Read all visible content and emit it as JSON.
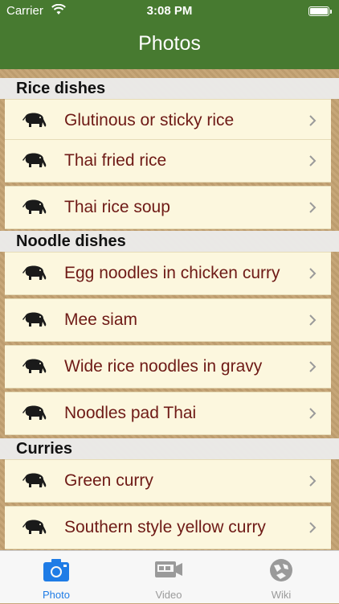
{
  "status": {
    "carrier": "Carrier",
    "time": "3:08 PM"
  },
  "nav": {
    "title": "Photos"
  },
  "sections": [
    {
      "title": "Rice dishes",
      "items": [
        "Glutinous or sticky rice",
        "Thai fried rice",
        "Thai rice soup"
      ]
    },
    {
      "title": "Noodle dishes",
      "items": [
        "Egg noodles in chicken curry",
        "Mee siam",
        "Wide rice noodles in gravy",
        "Noodles pad Thai"
      ]
    },
    {
      "title": "Curries",
      "items": [
        "Green curry",
        "Southern style yellow curry"
      ]
    }
  ],
  "tabs": [
    {
      "label": "Photo",
      "icon": "camera-icon",
      "active": true
    },
    {
      "label": "Video",
      "icon": "video-camera-icon",
      "active": false
    },
    {
      "label": "Wiki",
      "icon": "wiki-globe-icon",
      "active": false
    }
  ],
  "colors": {
    "nav_bar": "#477a30",
    "row_bg": "#fcf7de",
    "row_text": "#6e1a16",
    "tab_active": "#1f7ce6"
  }
}
